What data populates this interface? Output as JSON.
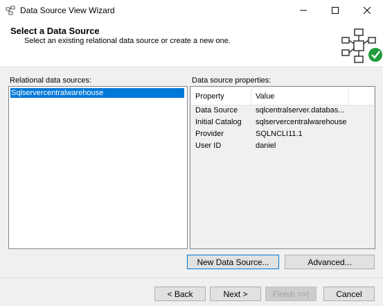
{
  "window": {
    "title": "Data Source View Wizard",
    "minimize": "—",
    "maximize": "☐",
    "close": "✕"
  },
  "header": {
    "title": "Select a Data Source",
    "subtitle": "Select an existing relational data source or create a new one."
  },
  "relational": {
    "label": "Relational data sources:",
    "items": [
      "Sqlservercentralwarehouse"
    ],
    "selected_index": 0
  },
  "properties": {
    "label": "Data source properties:",
    "columns": [
      "Property",
      "Value"
    ],
    "rows": [
      {
        "name": "Data Source",
        "value": "sqlcentralserver.databas..."
      },
      {
        "name": "Initial Catalog",
        "value": "sqlservercentralwarehouse"
      },
      {
        "name": "Provider",
        "value": "SQLNCLI11.1"
      },
      {
        "name": "User ID",
        "value": "daniel"
      }
    ]
  },
  "buttons": {
    "new_data_source": "New Data Source...",
    "advanced": "Advanced...",
    "back": "< Back",
    "next": "Next >",
    "finish": "Finish >>|",
    "cancel": "Cancel"
  },
  "colors": {
    "selection": "#0078d7",
    "check_green": "#1f9d3a"
  }
}
